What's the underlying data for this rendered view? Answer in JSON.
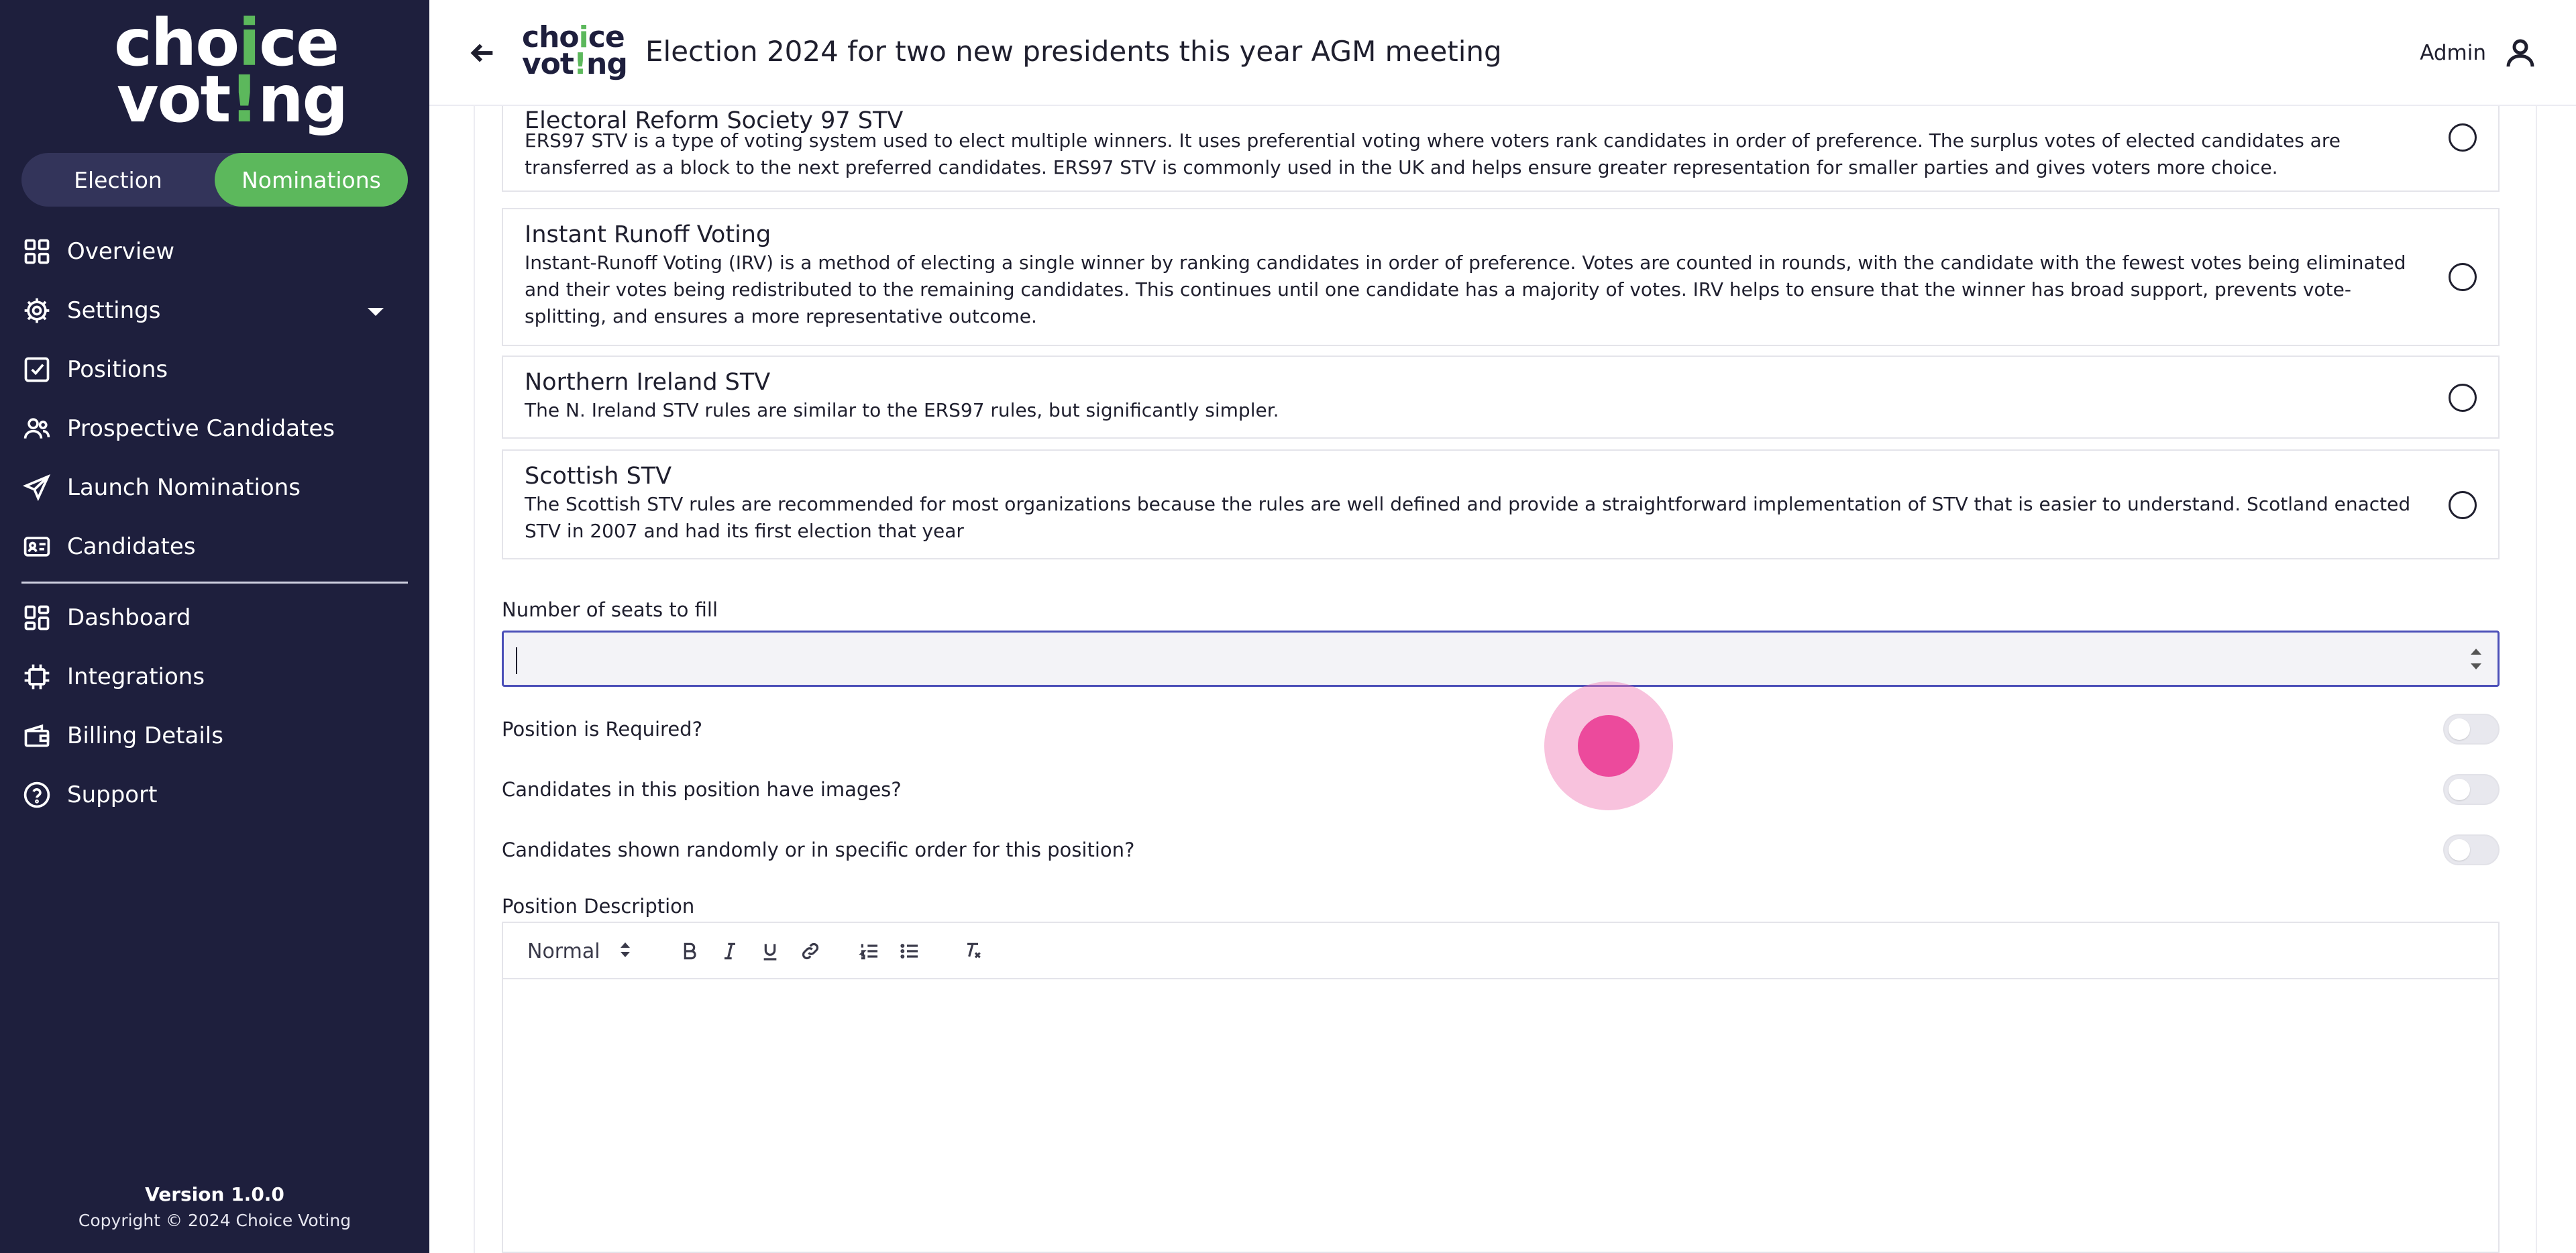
{
  "sidebar": {
    "logo": {
      "line1_a": "cho",
      "line1_b": "i",
      "line1_c": "ce",
      "line2_a": "vot",
      "line2_b": "!",
      "line2_c": "ng"
    },
    "toggle": {
      "election": "Election",
      "nominations": "Nominations",
      "active": "nominations"
    },
    "nav_top": [
      {
        "label": "Overview",
        "icon": "grid-icon"
      },
      {
        "label": "Settings",
        "icon": "gear-icon",
        "expandable": true
      },
      {
        "label": "Positions",
        "icon": "checkbox-icon"
      },
      {
        "label": "Prospective Candidates",
        "icon": "users-icon"
      },
      {
        "label": "Launch Nominations",
        "icon": "send-icon"
      },
      {
        "label": "Candidates",
        "icon": "id-card-icon"
      }
    ],
    "nav_bottom": [
      {
        "label": "Dashboard",
        "icon": "dashboard-icon"
      },
      {
        "label": "Integrations",
        "icon": "chip-icon"
      },
      {
        "label": "Billing Details",
        "icon": "wallet-icon"
      },
      {
        "label": "Support",
        "icon": "help-circle-icon"
      }
    ],
    "version": "Version 1.0.0",
    "copyright": "Copyright © 2024 Choice Voting"
  },
  "header": {
    "mini_logo": {
      "line1_a": "cho",
      "line1_b": "i",
      "line1_c": "ce",
      "line2_a": "vot",
      "line2_b": "!",
      "line2_c": "ng"
    },
    "title": "Election 2024 for two new presidents this year AGM meeting",
    "user_label": "Admin"
  },
  "methods": [
    {
      "title": "Electoral Reform Society 97 STV",
      "description": "ERS97 STV is a type of voting system used to elect multiple winners. It uses preferential voting where voters rank candidates in order of preference. The surplus votes of elected candidates are transferred as a block to the next preferred candidates. ERS97 STV is commonly used in the UK and helps ensure greater representation for smaller parties and gives voters more choice."
    },
    {
      "title": "Instant Runoff Voting",
      "description": "Instant-Runoff Voting (IRV) is a method of electing a single winner by ranking candidates in order of preference. Votes are counted in rounds, with the candidate with the fewest votes being eliminated and their votes being redistributed to the remaining candidates. This continues until one candidate has a majority of votes. IRV helps to ensure that the winner has broad support, prevents vote-splitting, and ensures a more representative outcome."
    },
    {
      "title": "Northern Ireland STV",
      "description": "The N. Ireland STV rules are similar to the ERS97 rules, but significantly simpler."
    },
    {
      "title": "Scottish STV",
      "description": "The Scottish STV rules are recommended for most organizations because the rules are well defined and provide a straightforward implementation of STV that is easier to understand. Scotland enacted STV in 2007 and had its first election that year"
    }
  ],
  "form": {
    "seats_label": "Number of seats to fill",
    "seats_value": "",
    "required_label": "Position is Required?",
    "images_label": "Candidates in this position have images?",
    "order_label": "Candidates shown randomly or in specific order for this position?",
    "description_label": "Position Description",
    "editor": {
      "format_value": "Normal",
      "tools": [
        "bold-icon",
        "italic-icon",
        "underline-icon",
        "link-icon",
        "ordered-list-icon",
        "bullet-list-icon",
        "clear-format-icon"
      ]
    }
  },
  "colors": {
    "sidebar_bg": "#1e1f3d",
    "accent_green": "#5cb85c",
    "input_focus": "#4b4fb8",
    "touch_indicator": "#ec4a9c"
  }
}
